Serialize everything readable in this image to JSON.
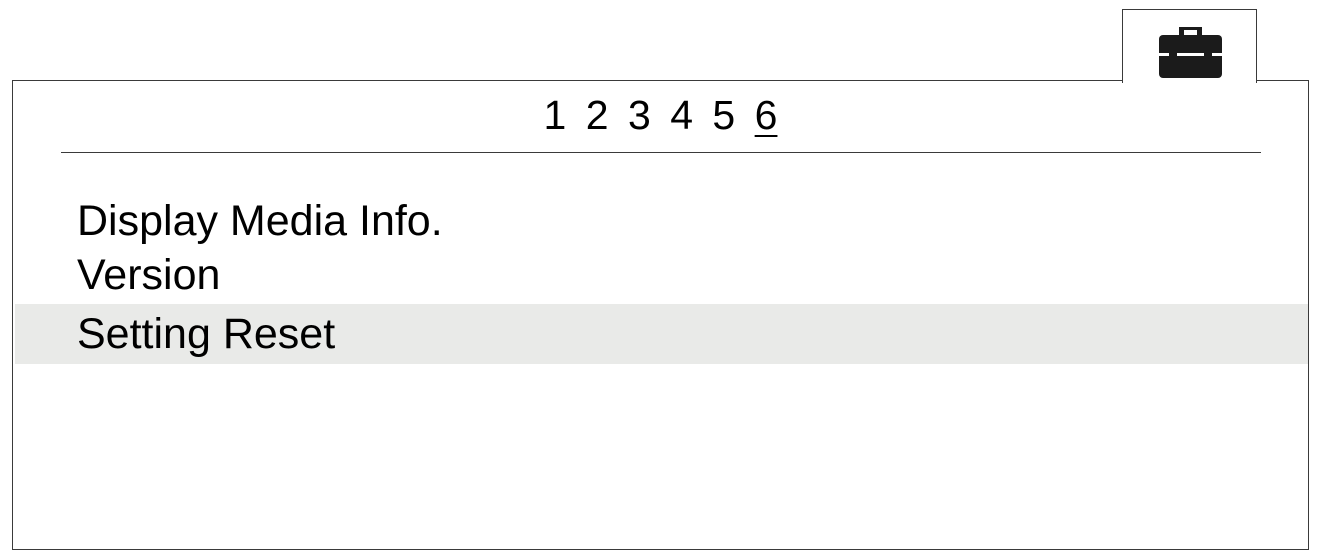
{
  "menu_tab": {
    "icon": "toolbox-icon"
  },
  "page_indicator": {
    "pages": [
      "1",
      "2",
      "3",
      "4",
      "5",
      "6"
    ],
    "current": "6"
  },
  "menu": {
    "items": [
      {
        "label": "Display Media Info."
      },
      {
        "label": "Version"
      },
      {
        "label": "Setting Reset",
        "selected": true
      }
    ]
  }
}
